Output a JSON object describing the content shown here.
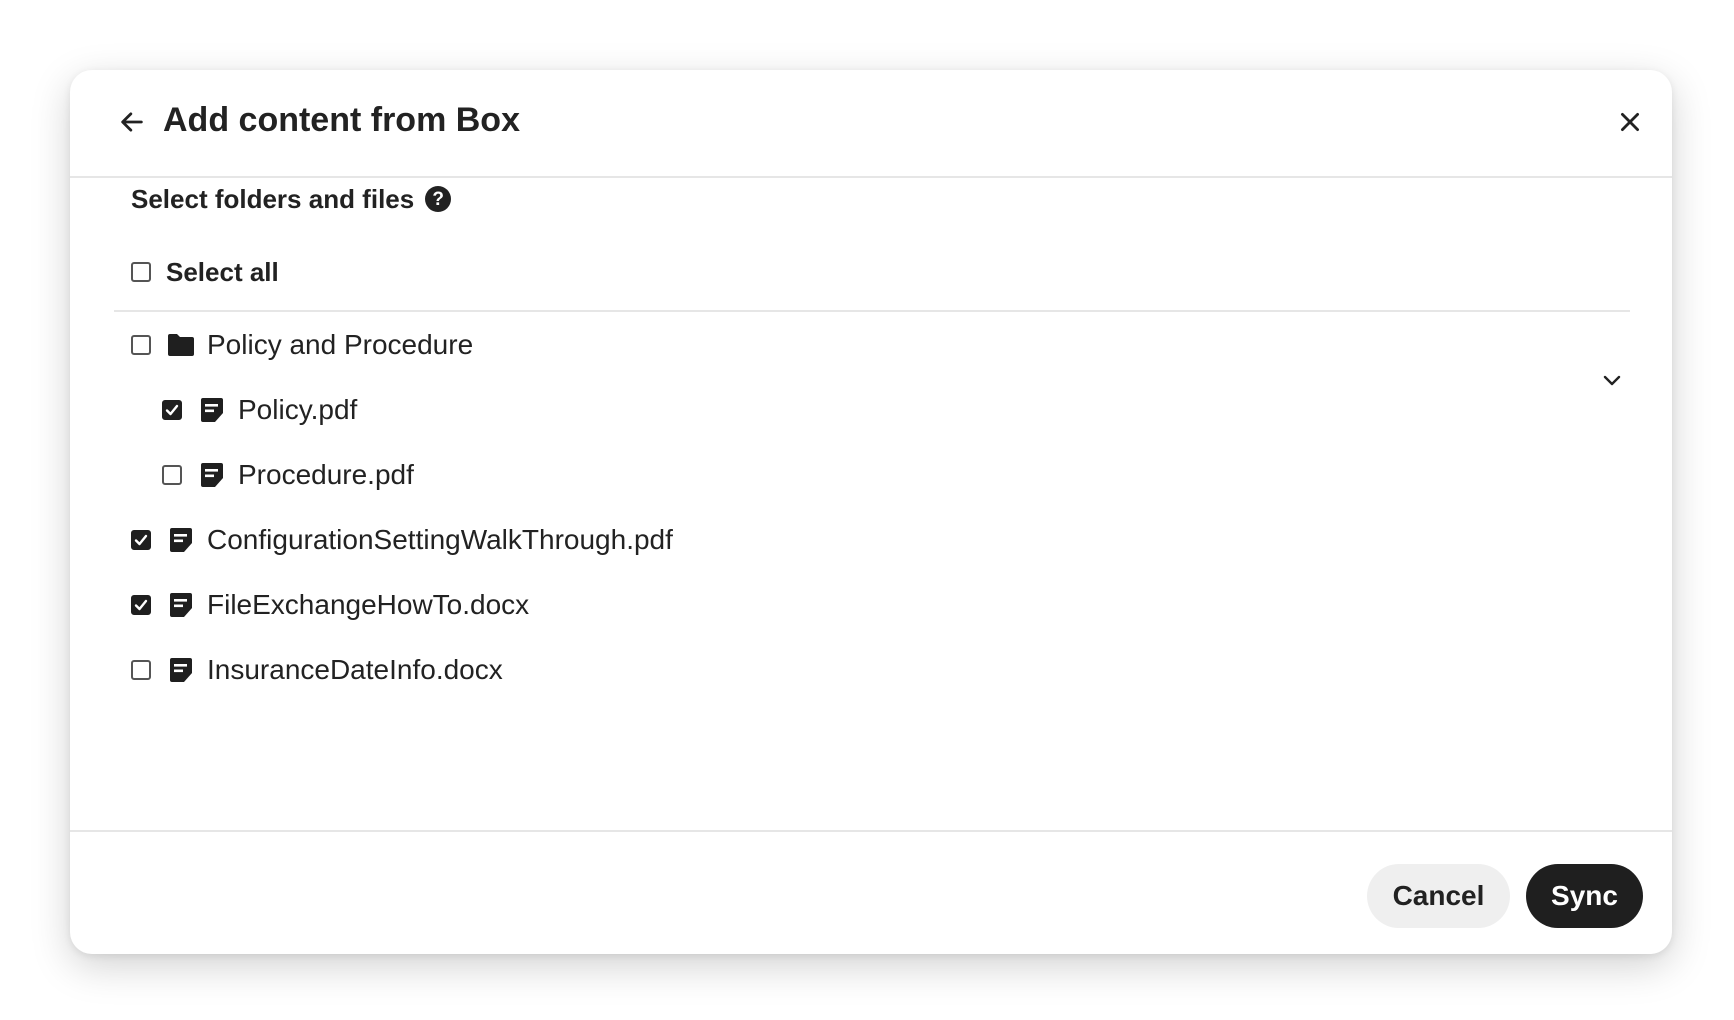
{
  "dialog": {
    "title": "Add content from Box",
    "back_icon": "arrow-left-icon",
    "close_icon": "close-icon"
  },
  "section": {
    "label": "Select folders and files",
    "help_icon_glyph": "?"
  },
  "select_all": {
    "label": "Select all",
    "checked": false
  },
  "items": [
    {
      "label": "Policy and Procedure",
      "type": "folder",
      "icon": "folder-icon",
      "checked": false,
      "level": 0
    },
    {
      "label": "Policy.pdf",
      "type": "file",
      "icon": "file-icon",
      "checked": true,
      "level": 1
    },
    {
      "label": "Procedure.pdf",
      "type": "file",
      "icon": "file-icon",
      "checked": false,
      "level": 1
    },
    {
      "label": "ConfigurationSettingWalkThrough.pdf",
      "type": "file",
      "icon": "file-icon",
      "checked": true,
      "level": 0
    },
    {
      "label": "FileExchangeHowTo.docx",
      "type": "file",
      "icon": "file-icon",
      "checked": true,
      "level": 0
    },
    {
      "label": "InsuranceDateInfo.docx",
      "type": "file",
      "icon": "file-icon",
      "checked": false,
      "level": 0
    }
  ],
  "footer": {
    "cancel_label": "Cancel",
    "sync_label": "Sync"
  },
  "colors": {
    "primary": "#1f1f1f",
    "secondary_button": "#efefef",
    "divider": "#e6e6e6",
    "text": "#222222"
  }
}
